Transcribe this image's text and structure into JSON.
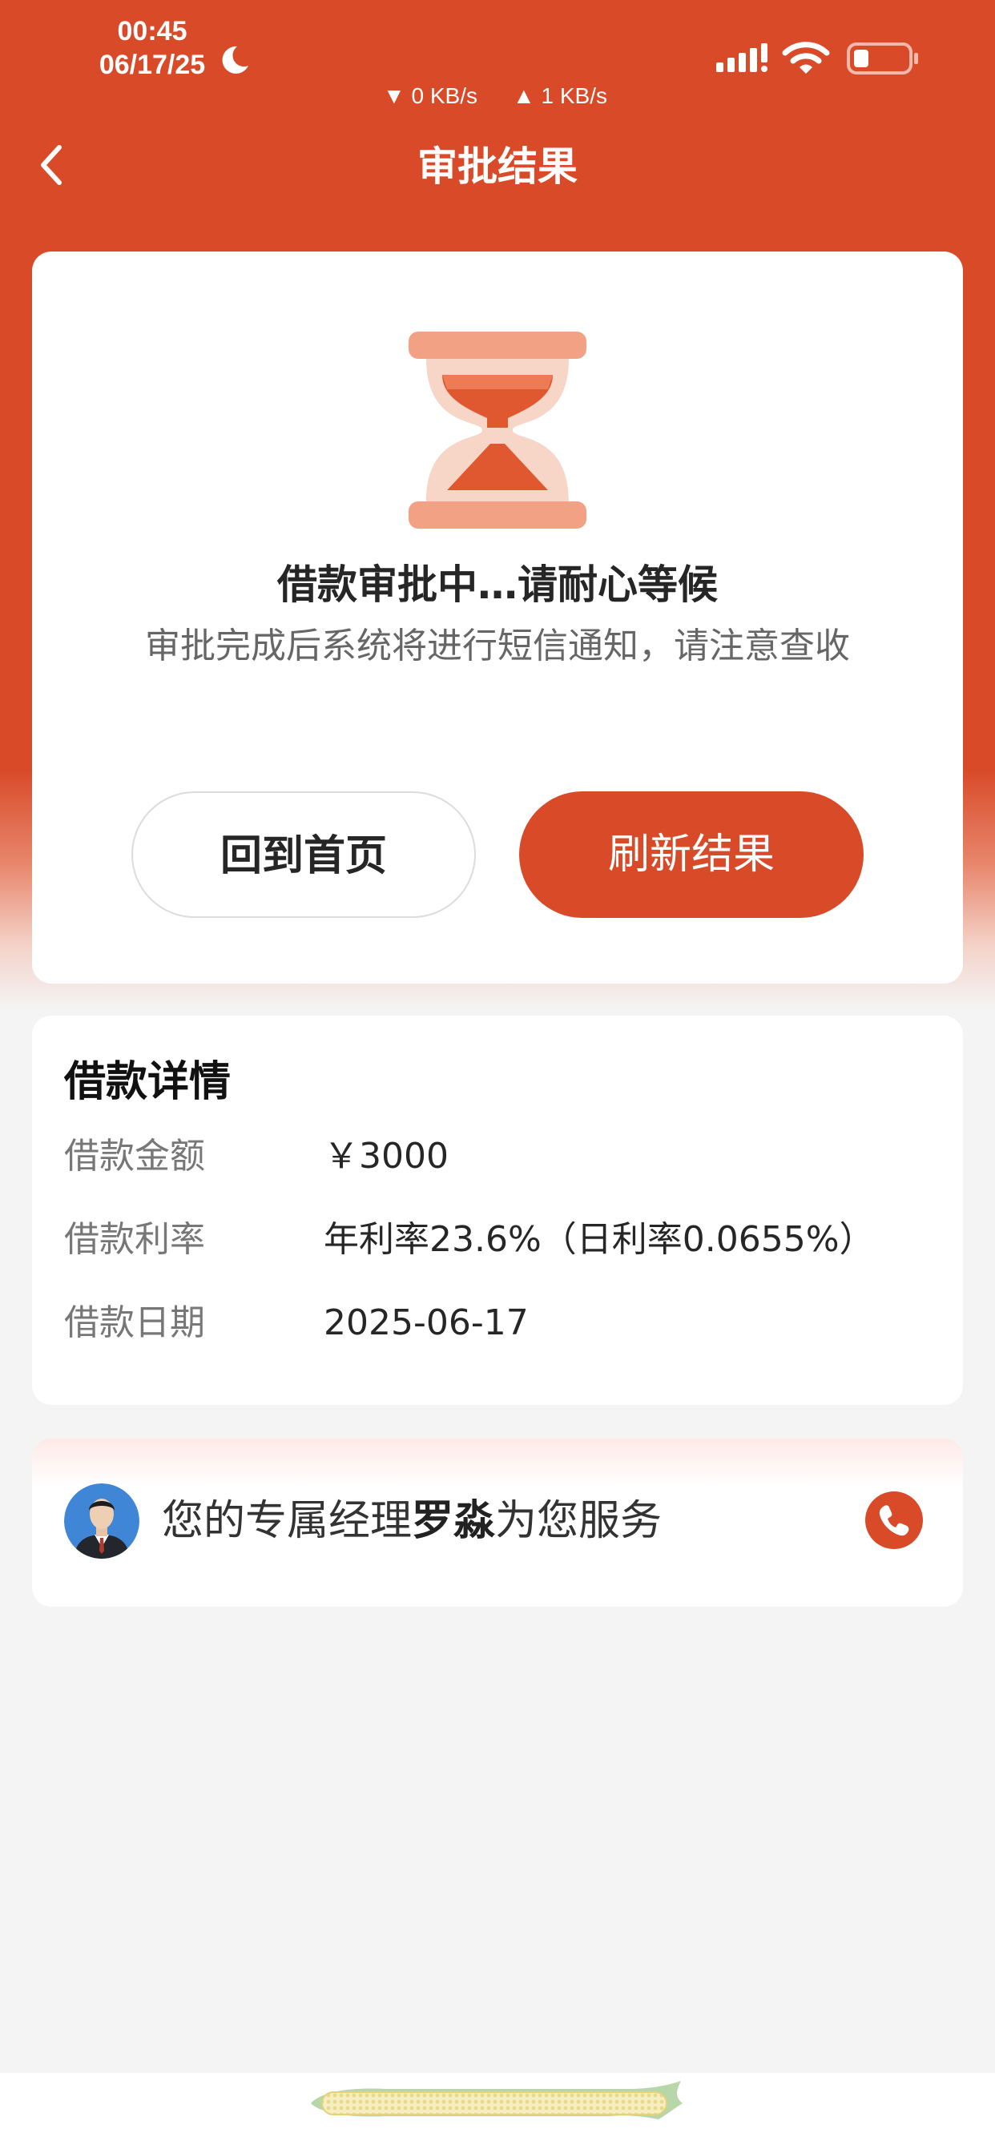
{
  "status_bar": {
    "time": "00:45",
    "date": "06/17/25",
    "net_down": "▼ 0 KB/s",
    "net_up": "▲ 1 KB/s"
  },
  "nav": {
    "title": "审批结果"
  },
  "status": {
    "title": "借款审批中…请耐心等候",
    "desc": "审批完成后系统将进行短信通知，请注意查收",
    "btn_home": "回到首页",
    "btn_refresh": "刷新结果"
  },
  "details": {
    "title": "借款详情",
    "rows": [
      {
        "label": "借款金额",
        "value": "￥3000"
      },
      {
        "label": "借款利率",
        "value": "年利率23.6%（日利率0.0655%）"
      },
      {
        "label": "借款日期",
        "value": "2025-06-17"
      }
    ]
  },
  "manager": {
    "prefix": "您的专属经理",
    "name": "罗淼",
    "suffix": "为您服务"
  },
  "colors": {
    "brand": "#d84a28",
    "background": "#f4f4f4"
  },
  "icons": [
    "moon-icon",
    "signal-icon",
    "wifi-icon",
    "battery-icon",
    "back-icon",
    "hourglass-icon",
    "avatar",
    "phone-icon"
  ]
}
